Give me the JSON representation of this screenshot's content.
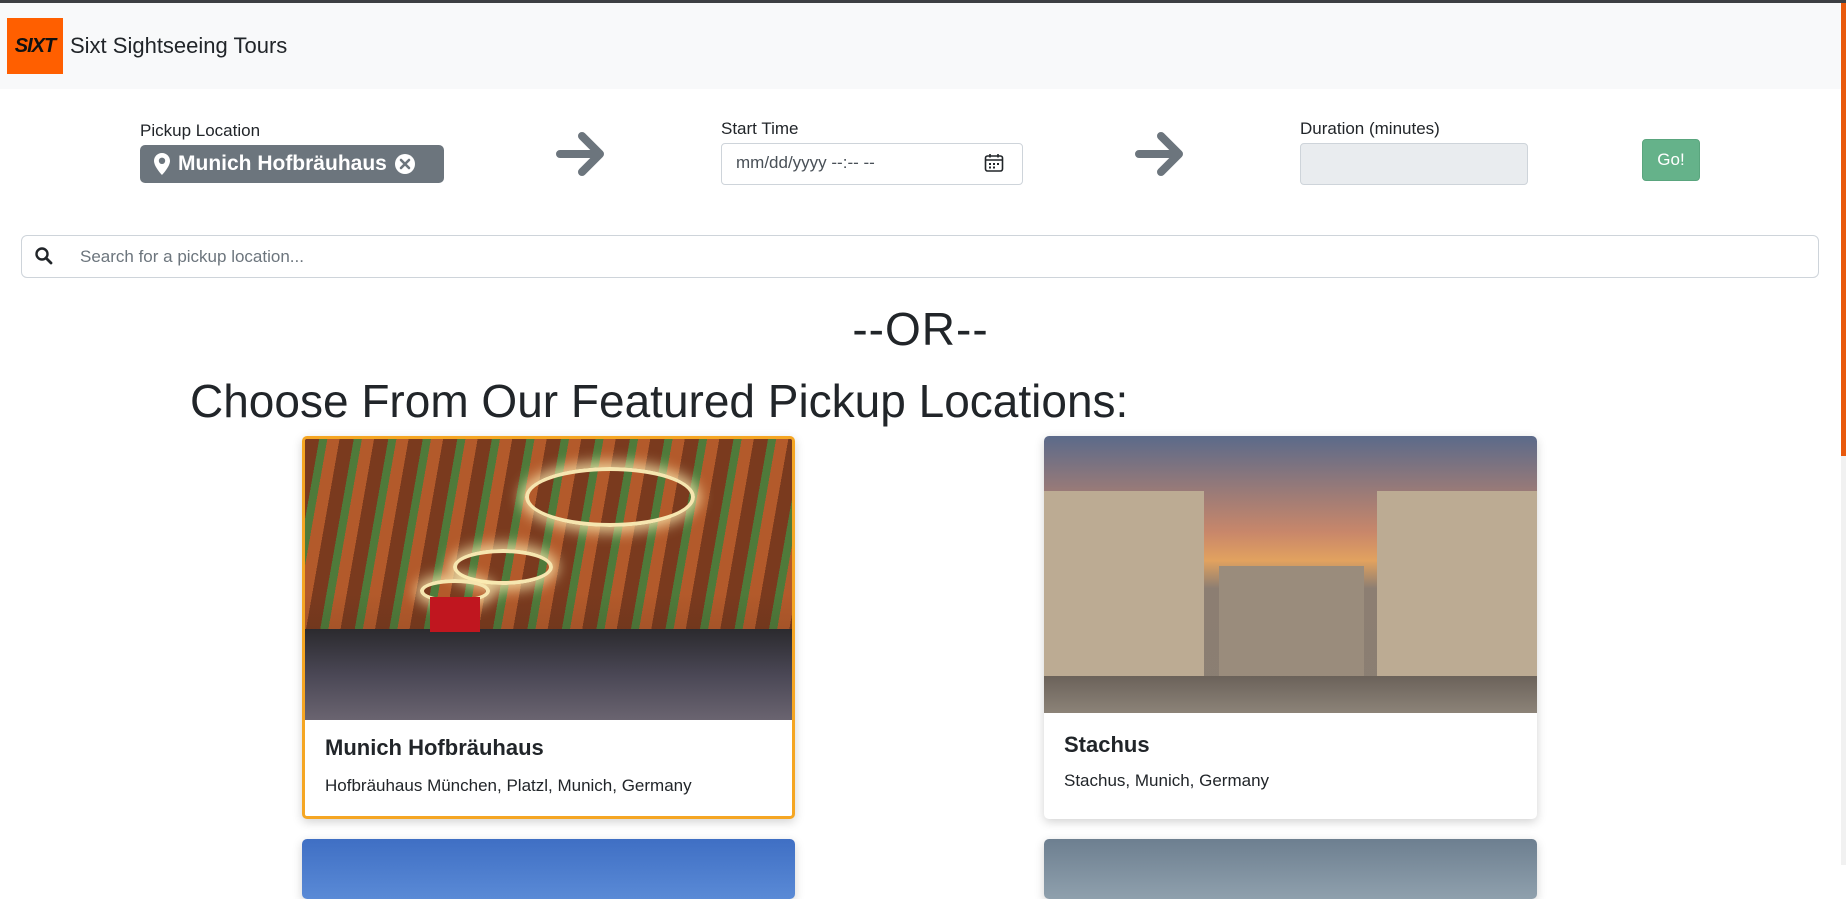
{
  "navbar": {
    "logo_text": "SIXT",
    "brand": "Sixt Sightseeing Tours"
  },
  "form": {
    "pickup_label": "Pickup Location",
    "pickup_value": "Munich Hofbräuhaus",
    "start_label": "Start Time",
    "start_value": "mm/dd/yyyy --:-- --",
    "duration_label": "Duration (minutes)",
    "duration_value": "",
    "go_label": "Go!"
  },
  "search": {
    "placeholder": "Search for a pickup location..."
  },
  "or_text": "--OR--",
  "featured_title": "Choose From Our Featured Pickup Locations:",
  "cards": [
    {
      "title": "Munich Hofbräuhaus",
      "subtitle": "Hofbräuhaus München, Platzl, Munich, Germany",
      "selected": true
    },
    {
      "title": "Stachus",
      "subtitle": "Stachus, Munich, Germany",
      "selected": false
    }
  ],
  "colors": {
    "brand_orange": "#ff5f00",
    "pill_gray": "#6c757d",
    "go_green": "#65b28a",
    "selected_border": "#f5a623"
  },
  "icons": [
    "map-pin-icon",
    "clear-icon",
    "arrow-right-icon",
    "calendar-icon",
    "search-icon"
  ]
}
